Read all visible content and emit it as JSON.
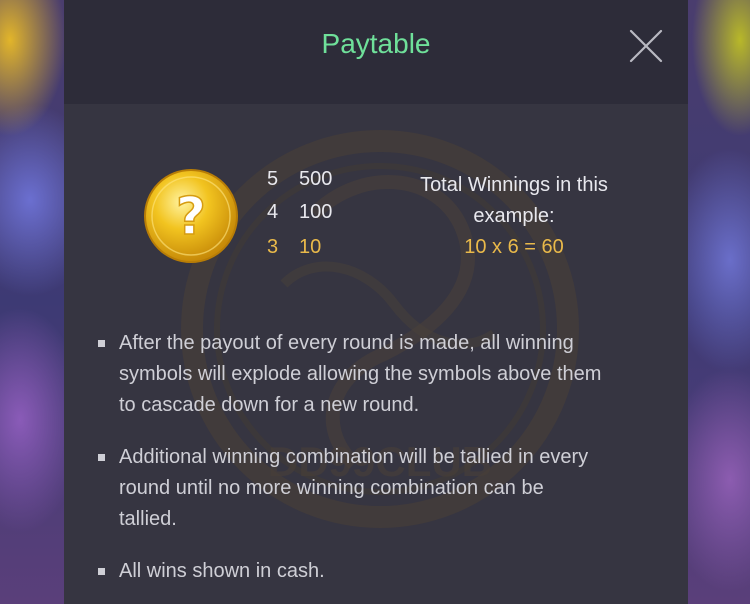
{
  "dialog": {
    "title": "Paytable",
    "close_icon": "close-icon"
  },
  "symbol": {
    "icon": "question-mark-coin-icon",
    "color": "#f2c420",
    "pays": [
      {
        "count": "5",
        "amount": "500",
        "color": "#e8e8ee"
      },
      {
        "count": "4",
        "amount": "100",
        "color": "#e8e8ee"
      },
      {
        "count": "3",
        "amount": "10",
        "color": "#e9b94a"
      }
    ]
  },
  "example": {
    "line1": "Total Winnings in this",
    "line2": "example:",
    "formula": "10 x 6 = 60"
  },
  "rules": [
    {
      "lines": [
        "After the payout of every round is made, all winning",
        "symbols will explode allowing the symbols above them",
        "to cascade down for a new round."
      ]
    },
    {
      "lines": [
        "Additional winning combination will be tallied in every",
        "round until no more winning combination can be",
        "tallied."
      ]
    },
    {
      "lines": [
        "All wins shown in cash."
      ]
    }
  ],
  "watermark": {
    "text": "DD99CLUB"
  },
  "colors": {
    "accent_green": "#6fe09a",
    "highlight_gold": "#e9b94a",
    "panel": "#2b2a37"
  }
}
